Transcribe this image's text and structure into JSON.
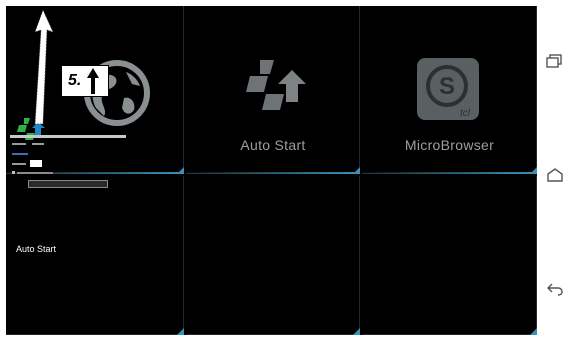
{
  "step_callout": {
    "number": "5."
  },
  "apps": [
    {
      "label": "",
      "icon": "globe-icon"
    },
    {
      "label": "Auto Start",
      "icon": "auto-start-icon"
    },
    {
      "label": "MicroBrowser",
      "icon": "microbrowser-icon"
    }
  ],
  "overlay_app": {
    "label": "Auto Start"
  },
  "navbar": {
    "icons": [
      "recent-apps-icon",
      "home-icon",
      "back-icon"
    ]
  },
  "colors": {
    "background": "#000000",
    "tile_edge": "#3a8fb8",
    "label": "#9aa0a2",
    "icon_green": "#2db34a",
    "icon_blue": "#1e88c8"
  }
}
